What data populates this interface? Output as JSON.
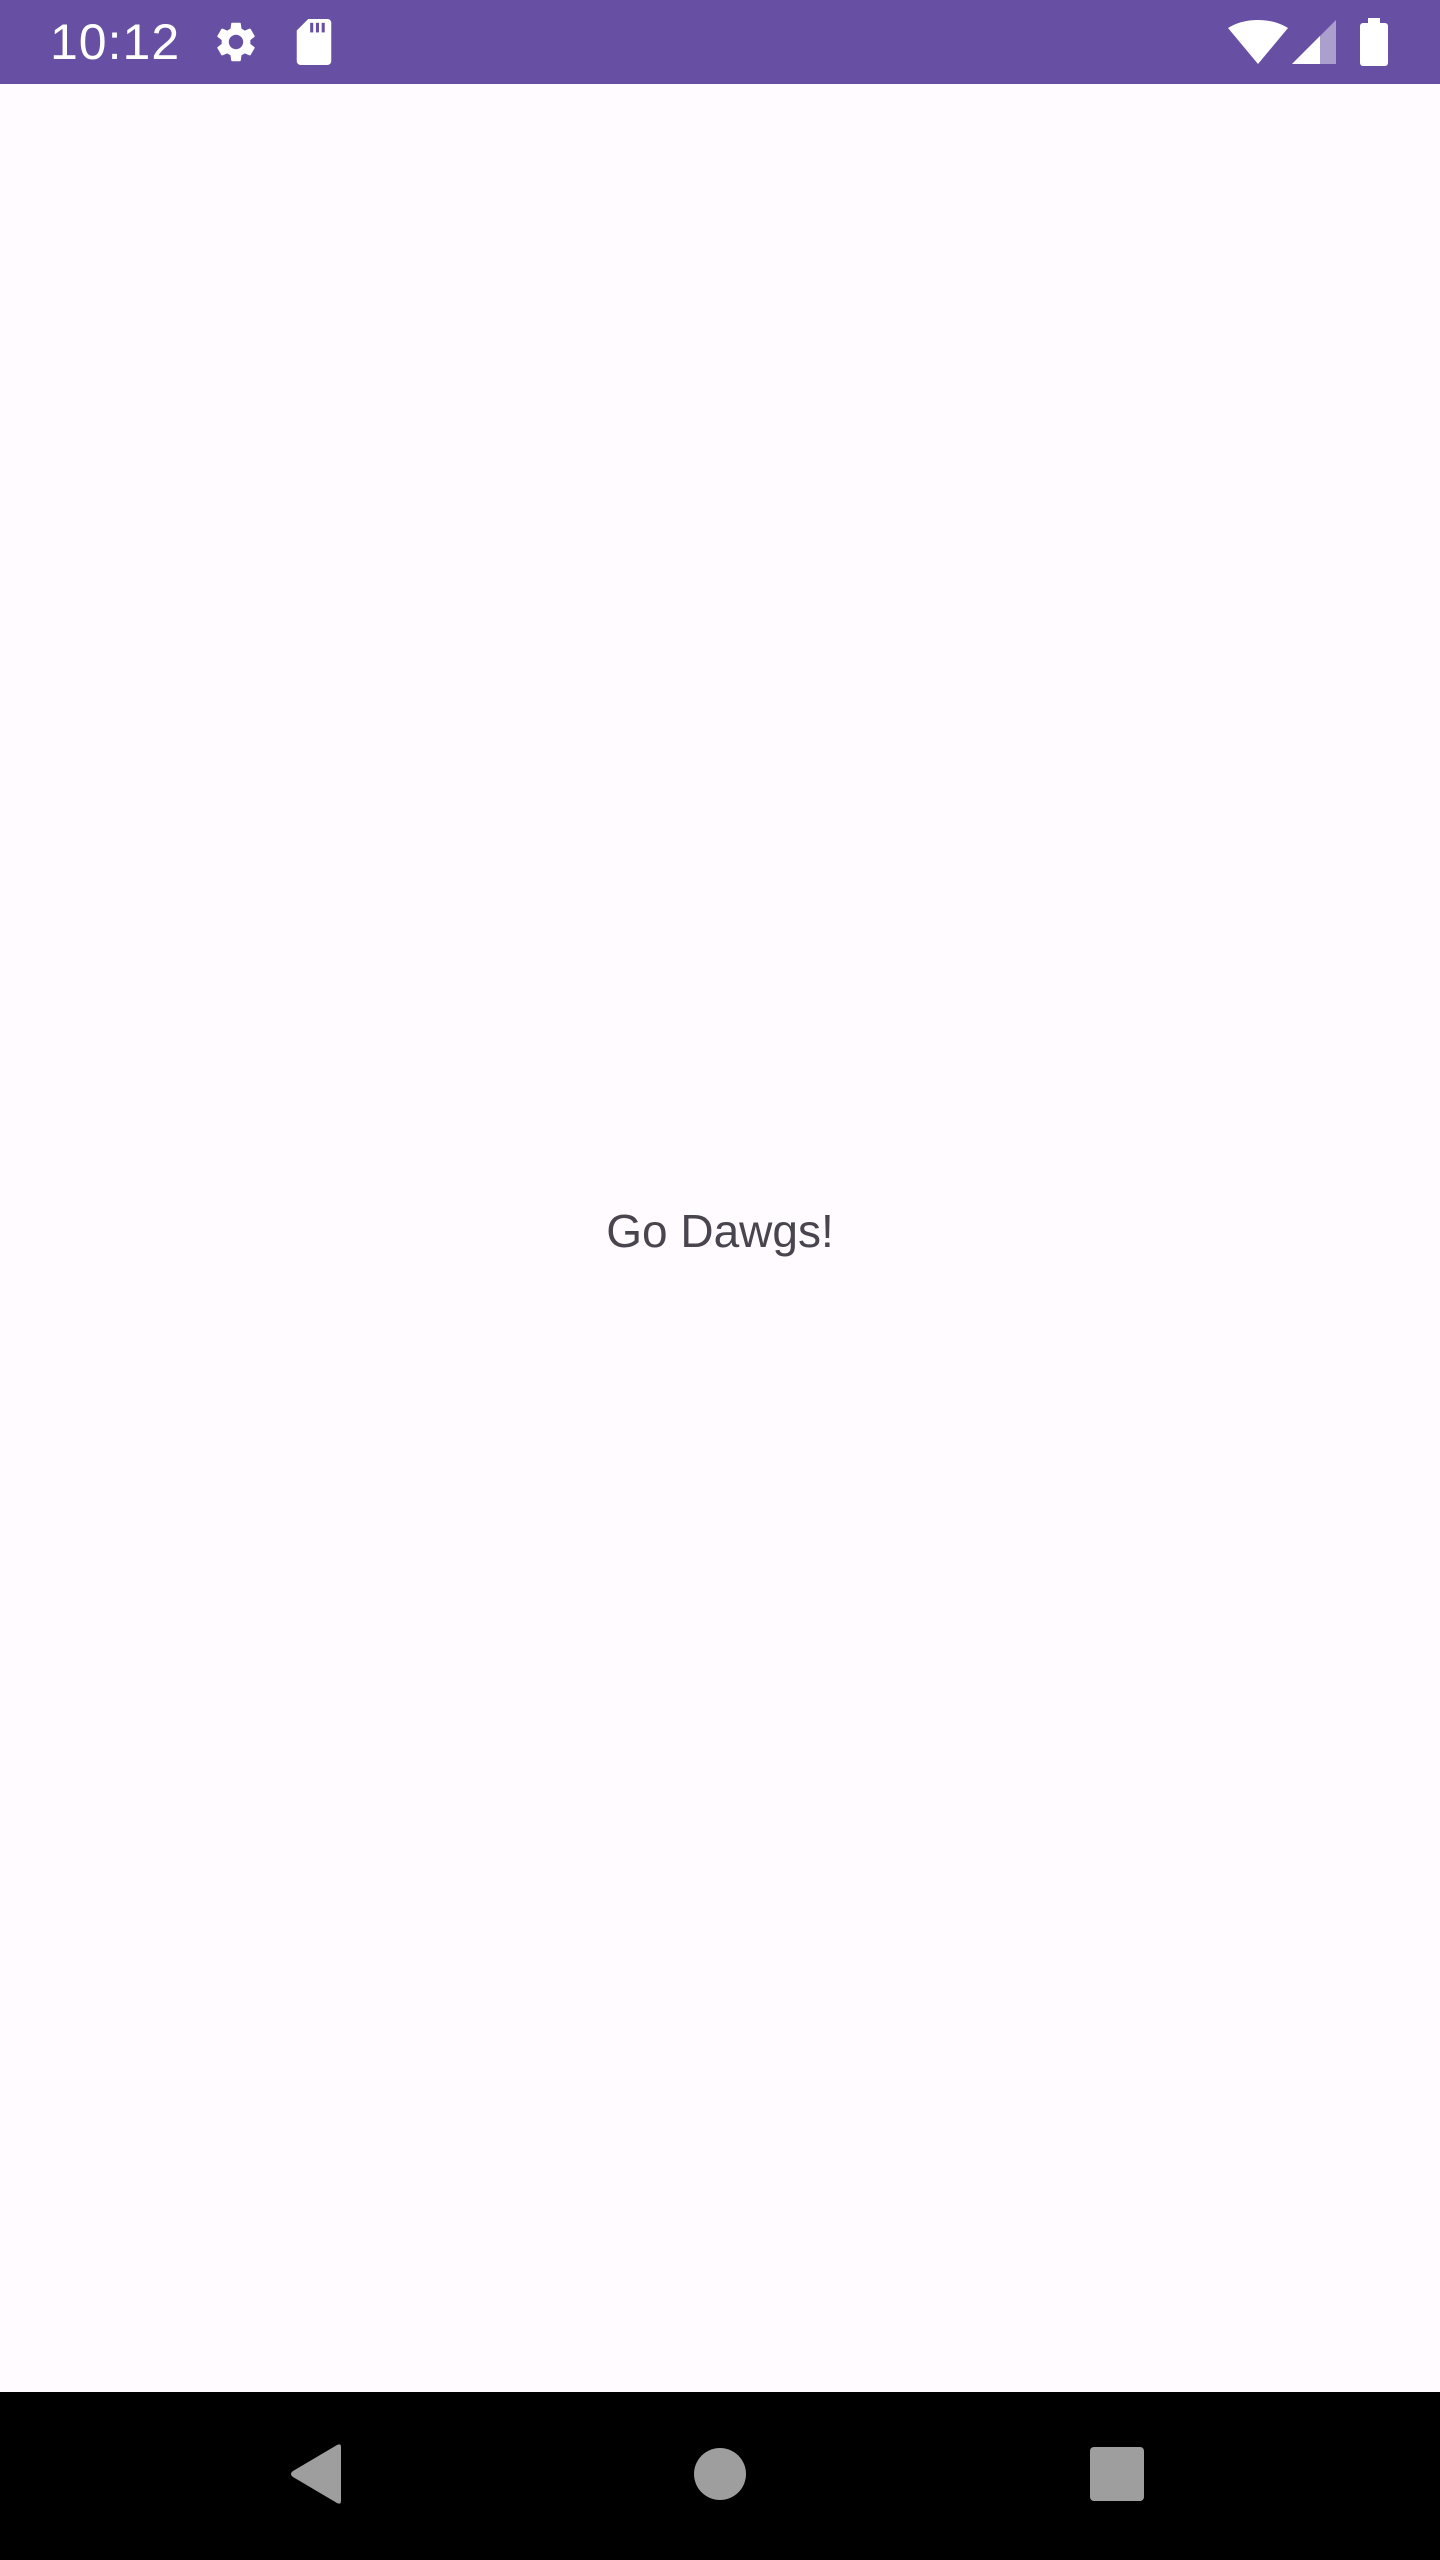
{
  "status_bar": {
    "time": "10:12",
    "background_color": "#6750A4",
    "icons": [
      "gear-icon",
      "sd-card-icon",
      "wifi-icon",
      "cellular-signal-icon",
      "battery-icon"
    ]
  },
  "main": {
    "message": "Go Dawgs!",
    "background_color": "#FFFBFE"
  },
  "nav_bar": {
    "buttons": [
      "back-icon",
      "home-icon",
      "recents-icon"
    ]
  }
}
